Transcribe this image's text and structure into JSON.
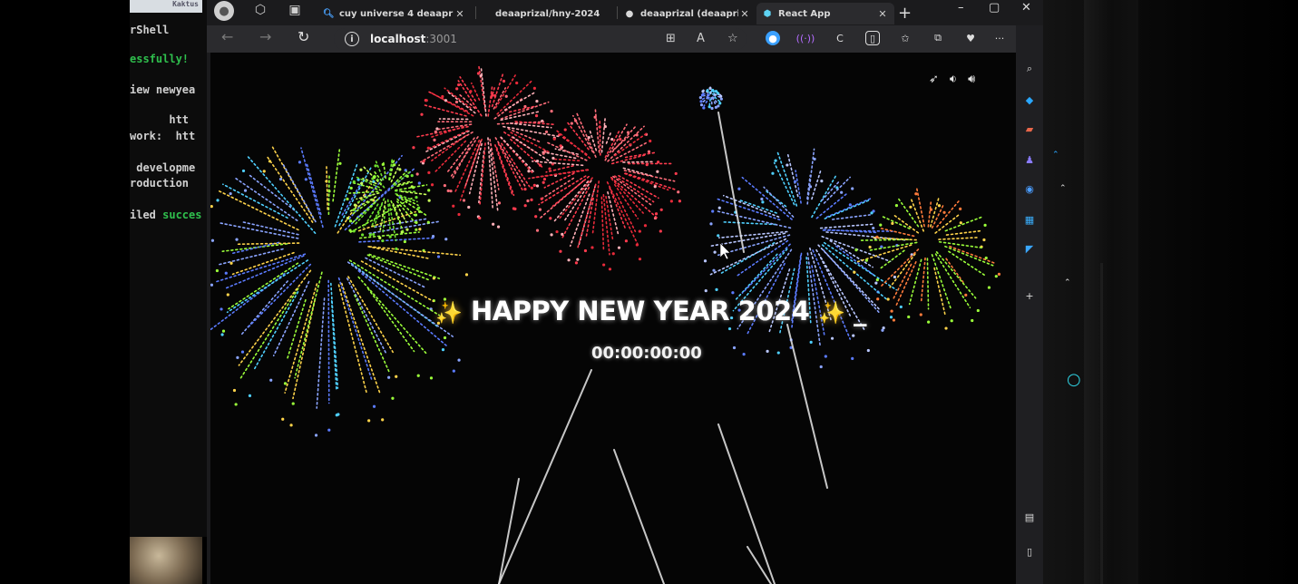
{
  "terminal": {
    "tab_stub_text": "Kaktus",
    "lines": [
      {
        "text": "rShell",
        "green": false
      },
      {
        "text": "essfully!",
        "green": true
      },
      {
        "text": "iew newyea",
        "green": false
      },
      {
        "text": "      htt",
        "green": false
      },
      {
        "text": "work:  htt",
        "green": false
      },
      {
        "text": " developme",
        "green": false
      },
      {
        "text": "roduction",
        "green": false
      },
      {
        "text": "iled succes",
        "green": false
      }
    ]
  },
  "browser": {
    "tabs": [
      {
        "label": "cuy universe 4 deaapr",
        "icon": "search-icon"
      },
      {
        "label": "deaaprizal/hny-2024",
        "icon": "none"
      },
      {
        "label": "deaaprizal (deaaprizal)",
        "icon": "github-icon"
      },
      {
        "label": "React App",
        "icon": "react-icon"
      }
    ],
    "new_tab": "+",
    "window_controls": {
      "minimize": "–",
      "maximize": "▢",
      "close": "✕"
    },
    "address": {
      "host": "localhost",
      "port": ":3001"
    },
    "nav": {
      "back": "←",
      "forward": "→",
      "refresh": "↻"
    }
  },
  "page": {
    "sound_controls": [
      "rocket-icon",
      "volume-low-icon",
      "volume-high-icon"
    ],
    "headline": {
      "sparkle": "✨",
      "text": "HAPPY NEW YEAR 2024",
      "cursor": "_"
    },
    "countdown": "00:00:00:00"
  },
  "colors": {
    "page_bg": "#050505",
    "browser_chrome": "#1b1b1d",
    "toolbar": "#2b2b2e",
    "firework_red": "#ff3b4e",
    "firework_green": "#9bff3a",
    "firework_blue": "#5b7bff",
    "sparkle_gold": "#ffcb3b"
  }
}
